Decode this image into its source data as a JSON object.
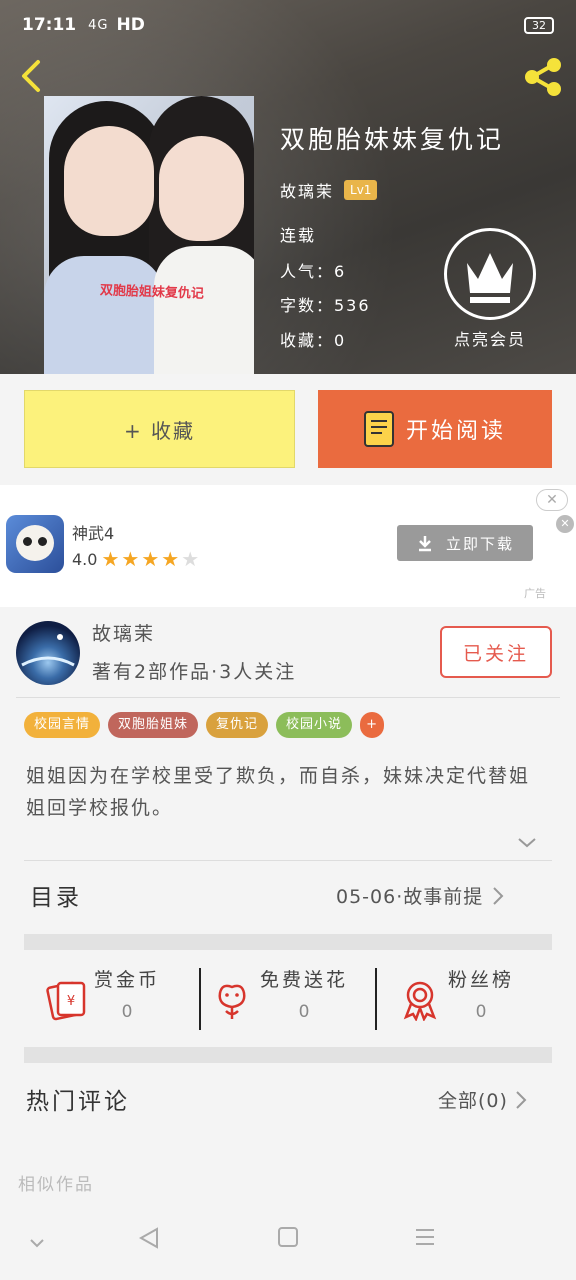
{
  "status_bar": {
    "time": "17:11",
    "signal": "4G",
    "network": "HD",
    "battery": "32"
  },
  "book": {
    "title": "双胞胎妹妹复仇记",
    "author": "故璃茉",
    "level": "Lv1",
    "status": "连载",
    "popularity": "人气：6",
    "word_count": "字数：536",
    "favorites": "收藏：0",
    "cover_caption": "双胞胎姐妹复仇记"
  },
  "vip": {
    "label": "点亮会员"
  },
  "actions": {
    "collect_label": "+ 收藏",
    "read_label": "开始阅读"
  },
  "ad": {
    "app_name": "神武4",
    "rating": "4.0",
    "stars_filled": 4,
    "stars_total": 5,
    "download_label": "立即下载",
    "ad_tag": "广告"
  },
  "author_card": {
    "name": "故璃茉",
    "stats": "著有2部作品·3人关注",
    "follow_label": "已关注"
  },
  "tags": [
    {
      "label": "校园言情",
      "color": "#f2b13b"
    },
    {
      "label": "双胞胎姐妹",
      "color": "#c0665c"
    },
    {
      "label": "复仇记",
      "color": "#d9a13d"
    },
    {
      "label": "校园小说",
      "color": "#8cbd5a"
    },
    {
      "label": "+",
      "color": "#ea6b3f"
    }
  ],
  "description": "姐姐因为在学校里受了欺负，而自杀，妹妹决定代替姐姐回学校报仇。",
  "catalog": {
    "title": "目录",
    "latest": "05-06·故事前提"
  },
  "rewards": [
    {
      "label": "赏金币",
      "count": "0"
    },
    {
      "label": "免费送花",
      "count": "0"
    },
    {
      "label": "粉丝榜",
      "count": "0"
    }
  ],
  "comments": {
    "title": "热门评论",
    "all_label": "全部(0)"
  },
  "similar": {
    "title": "相似作品"
  },
  "colors": {
    "accent_orange": "#ea6b3f",
    "collect_yellow": "#fcf27c",
    "follow_red": "#e55a4e"
  }
}
